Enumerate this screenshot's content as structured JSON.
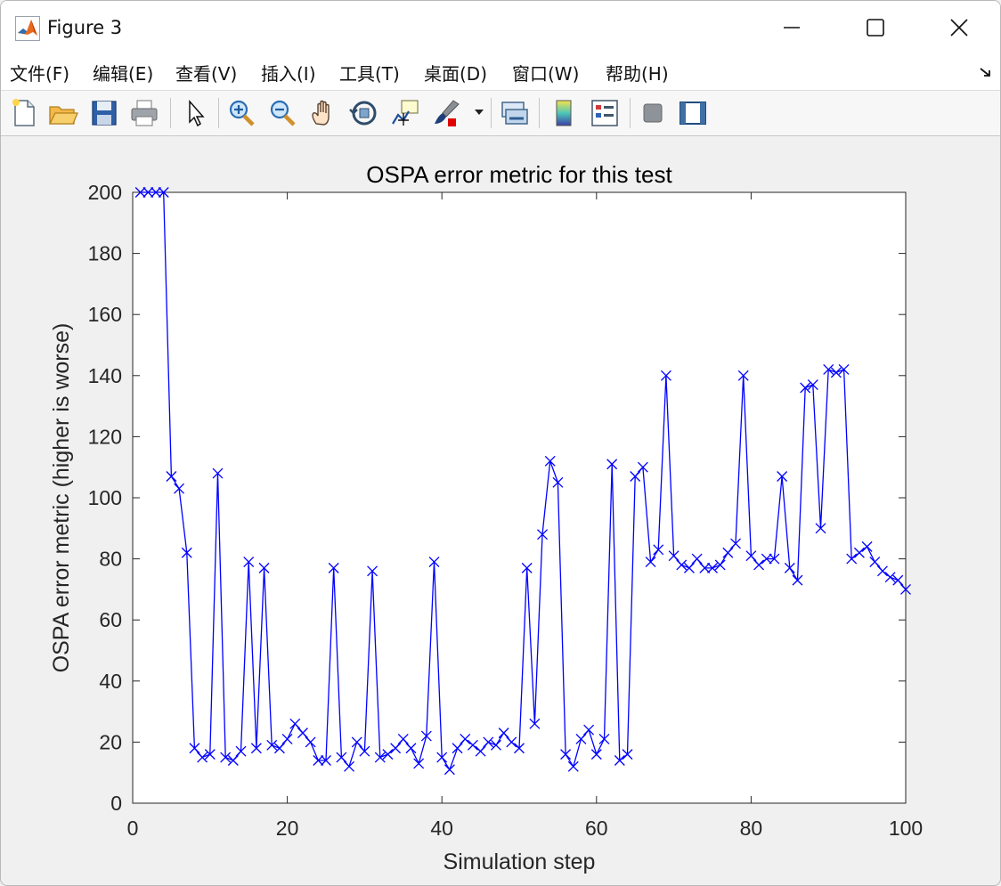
{
  "window": {
    "title": "Figure 3",
    "icon": "matlab-logo-icon",
    "controls": [
      "minimize-icon",
      "maximize-icon",
      "close-icon"
    ]
  },
  "menu": {
    "items": [
      "文件(F)",
      "编辑(E)",
      "查看(V)",
      "插入(I)",
      "工具(T)",
      "桌面(D)",
      "窗口(W)",
      "帮助(H)"
    ]
  },
  "toolbar": {
    "buttons": [
      "new-figure-icon",
      "open-file-icon",
      "save-icon",
      "print-icon",
      "select-arrow-icon",
      "zoom-in-icon",
      "zoom-out-icon",
      "pan-hand-icon",
      "rotate-3d-icon",
      "data-cursor-icon",
      "brush-icon",
      "link-plot-icon",
      "colorbar-icon",
      "legend-icon",
      "hide-plot-tools-icon",
      "show-plot-tools-icon"
    ]
  },
  "colors": {
    "series": "#0000ff",
    "axes": "#262626",
    "background": "#f0f0f0",
    "plot_bg": "#ffffff"
  },
  "chart_data": {
    "type": "line",
    "title": "OSPA error metric for this test",
    "xlabel": "Simulation step",
    "ylabel": "OSPA error metric (higher is worse)",
    "xlim": [
      0,
      100
    ],
    "ylim": [
      0,
      200
    ],
    "xticks": [
      0,
      20,
      40,
      60,
      80,
      100
    ],
    "yticks": [
      0,
      20,
      40,
      60,
      80,
      100,
      120,
      140,
      160,
      180,
      200
    ],
    "grid": false,
    "legend": "none",
    "marker": "x",
    "series": [
      {
        "color": "#0000ff",
        "x": [
          1,
          2,
          3,
          4,
          5,
          6,
          7,
          8,
          9,
          10,
          11,
          12,
          13,
          14,
          15,
          16,
          17,
          18,
          19,
          20,
          21,
          22,
          23,
          24,
          25,
          26,
          27,
          28,
          29,
          30,
          31,
          32,
          33,
          34,
          35,
          36,
          37,
          38,
          39,
          40,
          41,
          42,
          43,
          44,
          45,
          46,
          47,
          48,
          49,
          50,
          51,
          52,
          53,
          54,
          55,
          56,
          57,
          58,
          59,
          60,
          61,
          62,
          63,
          64,
          65,
          66,
          67,
          68,
          69,
          70,
          71,
          72,
          73,
          74,
          75,
          76,
          77,
          78,
          79,
          80,
          81,
          82,
          83,
          84,
          85,
          86,
          87,
          88,
          89,
          90,
          91,
          92,
          93,
          94,
          95,
          96,
          97,
          98,
          99,
          100
        ],
        "y": [
          200,
          200,
          200,
          200,
          107,
          103,
          82,
          18,
          15,
          16,
          108,
          15,
          14,
          17,
          79,
          18,
          77,
          19,
          18,
          21,
          26,
          23,
          20,
          14,
          14,
          77,
          15,
          12,
          20,
          17,
          76,
          15,
          16,
          18,
          21,
          18,
          13,
          22,
          79,
          15,
          11,
          18,
          21,
          19,
          17,
          20,
          19,
          23,
          20,
          18,
          77,
          26,
          88,
          112,
          105,
          16,
          12,
          21,
          24,
          16,
          21,
          111,
          14,
          16,
          107,
          110,
          79,
          83,
          140,
          81,
          78,
          77,
          80,
          77,
          77,
          78,
          82,
          85,
          140,
          81,
          78,
          80,
          80,
          107,
          77,
          73,
          136,
          137,
          90,
          142,
          141,
          142,
          80,
          82,
          84,
          79,
          76,
          74,
          73,
          70
        ]
      }
    ]
  }
}
